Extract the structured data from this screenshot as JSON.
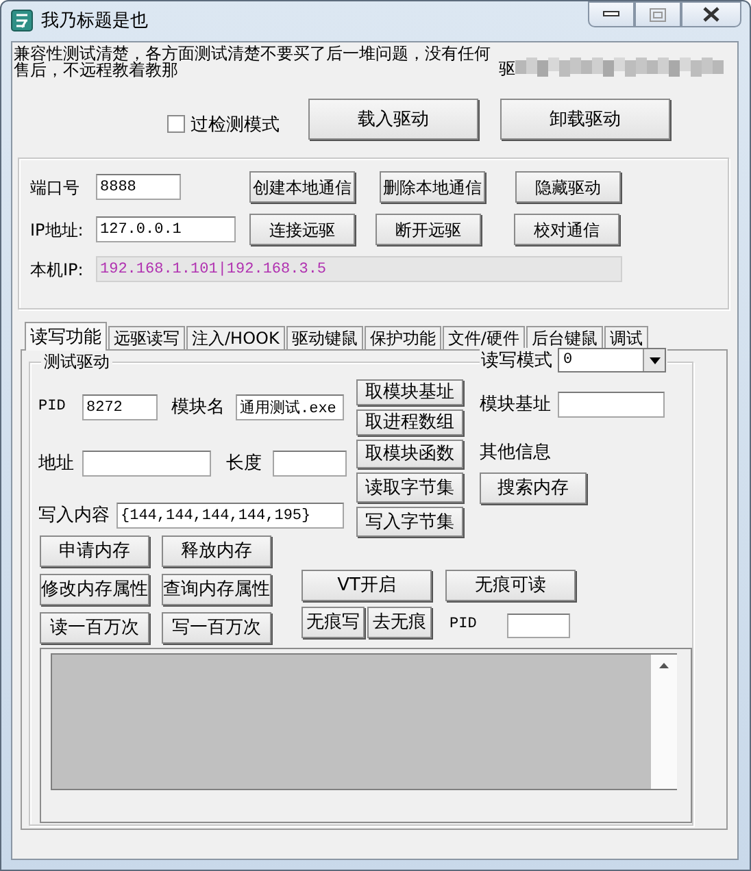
{
  "window": {
    "title": "我乃标题是也"
  },
  "notice": "兼容性测试清楚，各方面测试清楚不要买了后一堆问题，没有任何售后，不远程教着教那",
  "driver_label": "驱",
  "bypass_detection": {
    "label": "过检测模式",
    "checked": false
  },
  "driver_buttons": [
    "载入驱动",
    "卸载驱动"
  ],
  "comm": {
    "port_label": "端口号",
    "port": "8888",
    "ip_label": "IP地址:",
    "ip": "127.0.0.1",
    "local_ip_label": "本机IP:",
    "local_ip": "192.168.1.101|192.168.3.5",
    "buttons": [
      "创建本地通信",
      "删除本地通信",
      "隐藏驱动",
      "连接远驱",
      "断开远驱",
      "校对通信"
    ]
  },
  "tabs": [
    {
      "label": "读写功能",
      "selected": true
    },
    {
      "label": "远驱读写",
      "selected": false
    },
    {
      "label": "注入/HOOK",
      "selected": false
    },
    {
      "label": "驱动键鼠",
      "selected": false
    },
    {
      "label": "保护功能",
      "selected": false
    },
    {
      "label": "文件/硬件",
      "selected": false
    },
    {
      "label": "后台键鼠",
      "selected": false
    },
    {
      "label": "调试",
      "selected": false
    }
  ],
  "test_group": {
    "title": "测试驱动",
    "mode_label": "读写模式",
    "mode": "0",
    "pid_label": "PID",
    "pid": "8272",
    "module_label": "模块名",
    "module": "通用测试.exe",
    "address_label": "地址",
    "length_label": "长度",
    "content_label": "写入内容",
    "content": "{144,144,144,144,195}",
    "module_buttons": [
      "取模块基址",
      "取进程数组",
      "取模块函数",
      "读取字节集",
      "写入字节集"
    ],
    "base_label": "模块基址",
    "other_label": "其他信息",
    "search_button": "搜索内存",
    "memory_buttons": [
      "申请内存",
      "释放内存",
      "修改内存属性",
      "查询内存属性",
      "读一百万次",
      "写一百万次"
    ],
    "vt_button": "VT开启",
    "traceless_read_button": "无痕可读",
    "traceless_write_button": "无痕写",
    "remove_traceless_button": "去无痕",
    "pid2_label": "PID"
  }
}
